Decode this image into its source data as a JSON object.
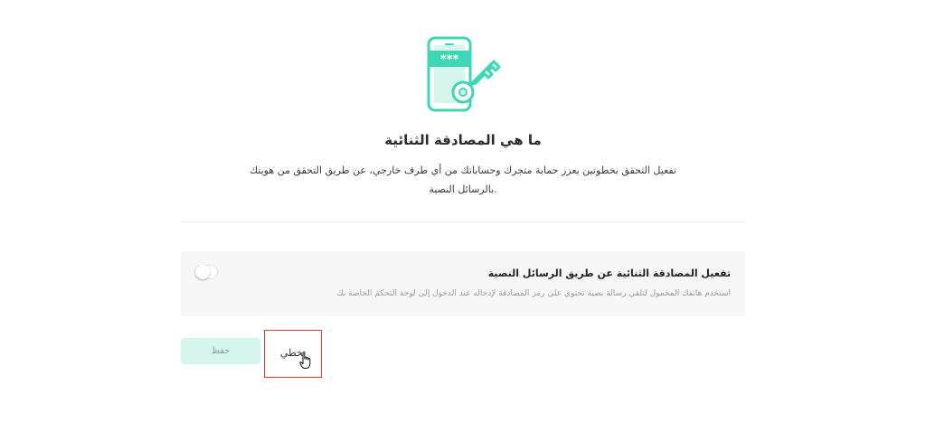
{
  "header": {
    "title": "ما هي المصادقة الثنائية",
    "description_line1": "تفعيل التحقق بخطوتين يعزز حماية متجرك وحساباتك من أي طرف خارجي، عن طريق التحقق من هويتك",
    "description_line2": ".بالرسائل النصية"
  },
  "sms_option": {
    "title": "تفعيل المصادقة الثنائية عن طريق الرسائل النصية",
    "subtitle": "استخدم هاتفك المحمول لتلقي رسالة نصية تحتوي على رمز المصادقة لإدخاله عند الدخول إلى لوحة التحكم الخاصة بك",
    "toggle_on": false
  },
  "actions": {
    "save_label": "حفظ",
    "skip_label": "تخطي"
  },
  "colors": {
    "accent": "#3ed6b3",
    "save_bg": "#d6f5ec",
    "highlight": "#e53935"
  },
  "icons": {
    "illustration": "phone-key-icon",
    "cursor": "hand-pointer-icon"
  }
}
